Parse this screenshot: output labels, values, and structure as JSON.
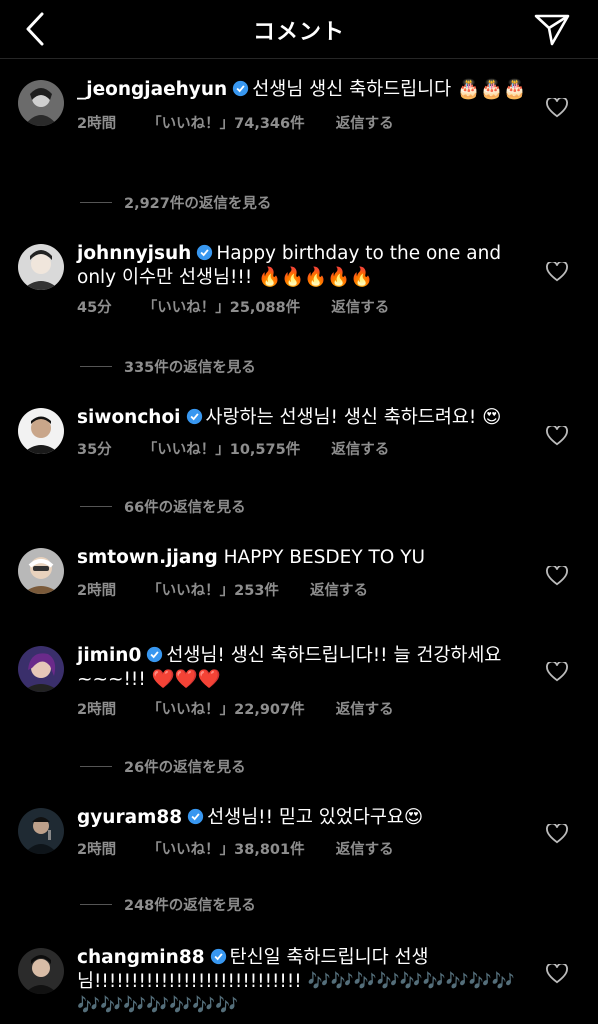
{
  "header": {
    "title": "コメント"
  },
  "comments": [
    {
      "username": "_jeongjaehyun",
      "verified": true,
      "text": "선생님 생신 축하드립니다 🎂🎂🎂",
      "time": "2時間",
      "likes": "「いいね！」74,346件",
      "reply": "返信する",
      "view_replies": "2,927件の返信を見る"
    },
    {
      "username": "johnnyjsuh",
      "verified": true,
      "text": "Happy birthday to the one and only 이수만 선생님!!! 🔥🔥🔥🔥🔥",
      "time": "45分",
      "likes": "「いいね！」25,088件",
      "reply": "返信する",
      "view_replies": "335件の返信を見る"
    },
    {
      "username": "siwonchoi",
      "verified": true,
      "text": "사랑하는 선생님! 생신 축하드려요! 😍",
      "time": "35分",
      "likes": "「いいね！」10,575件",
      "reply": "返信する",
      "view_replies": "66件の返信を見る"
    },
    {
      "username": "smtown.jjang",
      "verified": false,
      "text": "HAPPY BESDEY TO YU",
      "time": "2時間",
      "likes": "「いいね！」253件",
      "reply": "返信する",
      "view_replies": ""
    },
    {
      "username": "jimin0",
      "verified": true,
      "text": "선생님! 생신 축하드립니다!! 늘 건강하세요 ~~~!!! ❤️❤️❤️",
      "time": "2時間",
      "likes": "「いいね！」22,907件",
      "reply": "返信する",
      "view_replies": "26件の返信を見る"
    },
    {
      "username": "gyuram88",
      "verified": true,
      "text": "선생님!! 믿고 있었다구요😍",
      "time": "2時間",
      "likes": "「いいね！」38,801件",
      "reply": "返信する",
      "view_replies": "248件の返信を見る"
    },
    {
      "username": "changmin88",
      "verified": true,
      "text": "탄신일 축하드립니다 선생님!!!!!!!!!!!!!!!!!!!!!!!!!!!! 🎶🎶🎶🎶🎶🎶🎶🎶🎶🎶🎶🎶🎶🎶🎶🎶",
      "time": "",
      "likes": "",
      "reply": "",
      "view_replies": ""
    }
  ],
  "icons": {
    "back": "chevron-left-icon",
    "send": "paper-plane-icon",
    "like": "heart-outline-icon",
    "verified": "verified-badge-icon"
  },
  "colors": {
    "background": "#000000",
    "text": "#ffffff",
    "muted": "#8e8e8e",
    "verified": "#3897f0"
  }
}
